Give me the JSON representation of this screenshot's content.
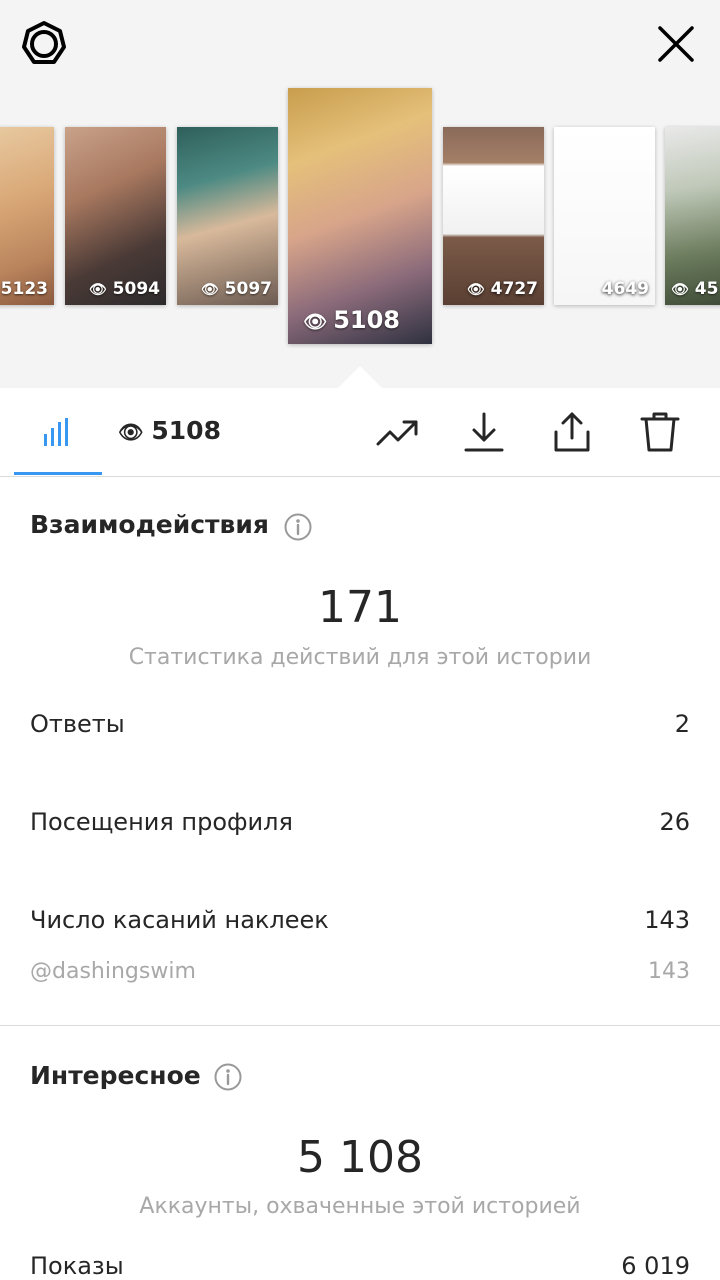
{
  "header": {
    "settings_icon": "gear-icon",
    "close_icon": "close-icon"
  },
  "stories": [
    {
      "views": "5123"
    },
    {
      "views": "5094"
    },
    {
      "views": "5097"
    },
    {
      "views": "5108",
      "active": true
    },
    {
      "views": "4727"
    },
    {
      "views": "4649"
    },
    {
      "views": "45"
    }
  ],
  "toolbar": {
    "insights_icon": "bar-chart-icon",
    "view_count": "5108",
    "icons": [
      "trending-icon",
      "download-icon",
      "share-icon",
      "trash-icon"
    ]
  },
  "interactions": {
    "title": "Взаимодействия",
    "total": "171",
    "caption": "Статистика действий для этой истории",
    "rows": [
      {
        "label": "Ответы",
        "value": "2"
      },
      {
        "label": "Посещения профиля",
        "value": "26"
      },
      {
        "label": "Число касаний наклеек",
        "value": "143"
      },
      {
        "label": "@dashingswim",
        "value": "143"
      }
    ]
  },
  "discovery": {
    "title": "Интересное",
    "total": "5 108",
    "caption": "Аккаунты, охваченные этой историей",
    "rows": [
      {
        "label": "Показы",
        "value": "6 019"
      }
    ]
  },
  "colors": {
    "accent": "#3897f0",
    "text": "#262626",
    "muted": "#a8a8a8",
    "divider": "#dbdbdb"
  }
}
